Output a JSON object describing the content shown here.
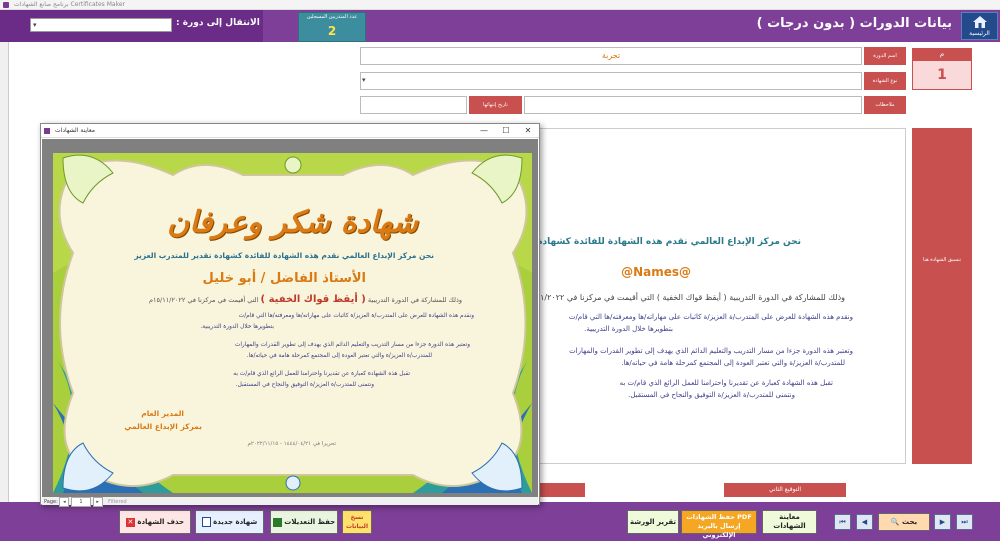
{
  "window": {
    "title": "برنامج صانع الشهادات Certificates Maker"
  },
  "header": {
    "title": "بيانات الدورات ( بدون درجات )",
    "home_label": "الرئيسية",
    "trainees_count_label": "عدد المتدربين المسجلين",
    "trainees_count": "2",
    "goto_label": "الانتقال إلى دورة :",
    "goto_value": ""
  },
  "form": {
    "id_label": "م",
    "id_value": "1",
    "course_name_label": "اسم الدورة",
    "course_name_value": "تجربة",
    "cert_type_label": "نوع الشهادة",
    "cert_type_value": "",
    "notes_label": "ملاحظات",
    "notes_value": "",
    "end_date_label": "تاريخ إنتهائها",
    "end_date_value": "",
    "format_label": "تنسيق الشهادة هنا"
  },
  "certificate_text": {
    "intro": "نحن مركز الإبداع العالمي نقدم هذه الشهادة للفائدة كشهادة تقدير للمتدرب العزيز",
    "names_field": "@Names@",
    "course_line": "وذلك للمشاركة في الدورة التدريبية  ( أيقظ قواك الخفية )  التي أقيمت في مركزنا في ١٥/١١/٢٠٢٢م",
    "line2": "ونقدم هذه الشهادة للعرض على المتدرب/ة العزيز/ة كاثبات على مهاراته/ها ومعرفته/ها التي قام/ت",
    "line3": "بتطويرها خلال الدورة التدريبية.",
    "line4": "وتعتبر هذه الدورة جزءا من مسار التدريب والتعليم الدائم الذي يهدف إلى تطوير القدرات والمهارات",
    "line5": "للمتدرب/ة العزيز/ة والتي تعتبر العودة إلى المجتمع كمرحلة هامة في حياته/ها.",
    "line6": "تقبل هذه الشهادة كعبارة عن تقديرنا واحترامنا للعمل الرائع الذي قام/ت به",
    "line7": "ونتمنى للمتدرب/ة العزيز/ة التوفيق والنجاح في المستقبل.",
    "signature_label": "التوقيع الثاني"
  },
  "preview": {
    "title": "معاينة الشهادات",
    "cert_heading": "شهادة شكر وعرفان",
    "intro": "نحن مركز الإبداع العالمي نقدم هذه الشهادة للفائدة كشهادة تقدير للمتدرب العزيز",
    "name": "الأستاذ الفاضل / أبو خليل",
    "course_prefix": "وذلك للمشاركة في الدورة التدريبية",
    "course_name": "( أيقظ قواك الخفية )",
    "course_suffix": "التي أقيمت في مركزنا في ١٥/١١/٢٠٢٢م",
    "line2": "ونقدم هذه الشهادة للعرض على المتدرب/ة العزيز/ة كاثبات على مهاراته/ها ومعرفته/ها التي قام/ت",
    "line3": "بتطويرها خلال الدورة التدريبية.",
    "line4": "وتعتبر هذه الدورة جزءا من مسار التدريب والتعليم الدائم الذي يهدف إلى تطوير القدرات والمهارات",
    "line5": "للمتدرب/ة العزيز/ة والتي تعتبر العودة إلى المجتمع كمرحلة هامة في حياته/ها.",
    "line6": "تقبل هذه الشهادة كعبارة عن تقديرنا واحترامنا للعمل الرائع الذي قام/ت به",
    "line7": "ونتمنى للمتدرب/ة العزيز/ة التوفيق والنجاح في المستقبل.",
    "director_title": "المدير العام",
    "director_org": "بمركز الإبداع العالمي",
    "date_line": "تحريرا في ١٤٤٤/٠٤/٢١ - ٢٠٢٢/١١/١٥م",
    "page_label": "Page:",
    "page_value": "1",
    "filtered_label": "Filtered"
  },
  "buttons": {
    "delete_cert": "حذف الشهادة",
    "new_cert": "شهادة جديدة",
    "save_changes": "حفظ التعديلات",
    "copy_data_line1": "نسخ",
    "copy_data_line2": "البيانات",
    "workshop_report": "تقرير الورشة",
    "save_pdf_line1": "حفظ الشهادات PDF",
    "save_pdf_line2": "إرسال بالبريد الإلكتروني",
    "preview_line1": "معاينة",
    "preview_line2": "الشهادات",
    "search": "بحث"
  },
  "colors": {
    "header_purple": "#7e3f98",
    "accent_red": "#c8504f",
    "count_teal": "#3c8d9e",
    "count_yellow": "#ffe14d",
    "cert_gold": "#d97a15",
    "cert_teal": "#2b8a8f",
    "cert_red": "#c0392b"
  }
}
